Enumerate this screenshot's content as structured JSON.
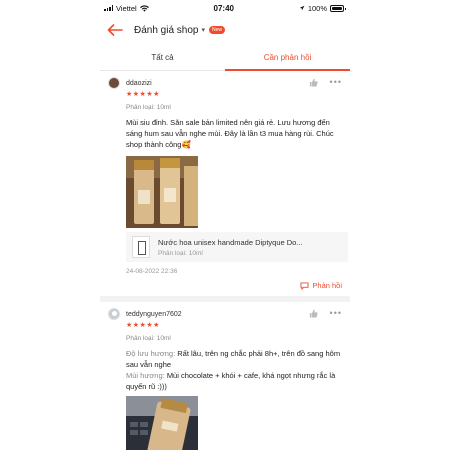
{
  "status_bar": {
    "carrier": "Viettel",
    "time": "07:40",
    "battery": "100%"
  },
  "header": {
    "title": "Đánh giá shop",
    "badge": "New"
  },
  "tabs": [
    {
      "label": "Tất cả",
      "active": false
    },
    {
      "label": "Cần phản hồi",
      "active": true
    }
  ],
  "reviews": [
    {
      "username": "ddaozizi",
      "stars": "★★★★★",
      "variant": "Phân loại: 10ml",
      "content": "Mùi siu đỉnh. Săn sale bản limited nên giá rẻ. Lưu hương đến sáng hum sau vẫn nghe mùi. Đây là lần t3 mua hàng rùi. Chúc shop thành công🥰",
      "product_name": "Nước hoa unisex handmade Diptyque Do...",
      "product_variant": "Phân loại: 10ml",
      "date": "24-08-2022 22:36",
      "reply_label": "Phản hồi"
    },
    {
      "username": "teddynguyen7602",
      "stars": "★★★★★",
      "variant": "Phân loại: 10ml",
      "attr1_label": "Độ lưu hương:",
      "attr1_value": "Rất lâu, trên ng chắc phải 8h+, trên đồ sang hôm sau vẫn nghe",
      "attr2_label": "Mùi hương:",
      "attr2_value": "Mùi chocolate + khói + cafe, khá ngọt nhưng rắc là quyến rũ :)))"
    }
  ],
  "colors": {
    "accent": "#ee4d2d",
    "muted": "#888888"
  }
}
